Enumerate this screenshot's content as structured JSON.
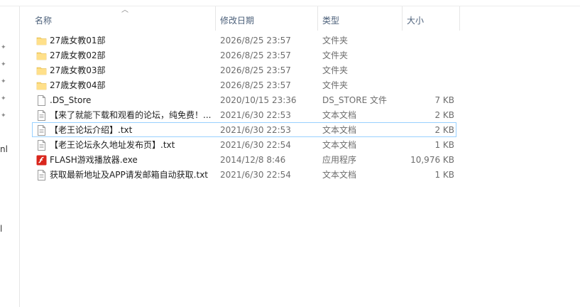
{
  "columns": {
    "name": "名称",
    "date": "修改日期",
    "type": "类型",
    "size": "大小"
  },
  "left_fragments": [
    "nl",
    "l"
  ],
  "files": [
    {
      "name": "27歳女教01部",
      "date": "2026/8/25 23:57",
      "type": "文件夹",
      "size": "",
      "icon": "folder-icon"
    },
    {
      "name": "27歳女教02部",
      "date": "2026/8/25 23:57",
      "type": "文件夹",
      "size": "",
      "icon": "folder-icon"
    },
    {
      "name": "27歳女教03部",
      "date": "2026/8/25 23:57",
      "type": "文件夹",
      "size": "",
      "icon": "folder-icon"
    },
    {
      "name": "27歳女教04部",
      "date": "2026/8/25 23:57",
      "type": "文件夹",
      "size": "",
      "icon": "folder-icon"
    },
    {
      "name": ".DS_Store",
      "date": "2020/10/15 23:36",
      "type": "DS_STORE 文件",
      "size": "7 KB",
      "icon": "file-icon"
    },
    {
      "name": "【来了就能下载和观看的论坛，纯免费！...",
      "date": "2021/6/30 22:53",
      "type": "文本文档",
      "size": "2 KB",
      "icon": "text-file-icon"
    },
    {
      "name": "【老王论坛介绍】.txt",
      "date": "2021/6/30 22:53",
      "type": "文本文档",
      "size": "2 KB",
      "icon": "text-file-icon"
    },
    {
      "name": "【老王论坛永久地址发布页】.txt",
      "date": "2021/6/30 22:54",
      "type": "文本文档",
      "size": "1 KB",
      "icon": "text-file-icon"
    },
    {
      "name": "FLASH游戏播放器.exe",
      "date": "2014/12/8 8:46",
      "type": "应用程序",
      "size": "10,976 KB",
      "icon": "flash-app-icon"
    },
    {
      "name": "获取最新地址及APP请发邮箱自动获取.txt",
      "date": "2021/6/30 22:54",
      "type": "文本文档",
      "size": "1 KB",
      "icon": "text-file-icon"
    }
  ],
  "colors": {
    "header_text": "#4c607a",
    "focus_border": "#99d1ff",
    "folder": "#f8d775",
    "flash": "#d9261c"
  }
}
